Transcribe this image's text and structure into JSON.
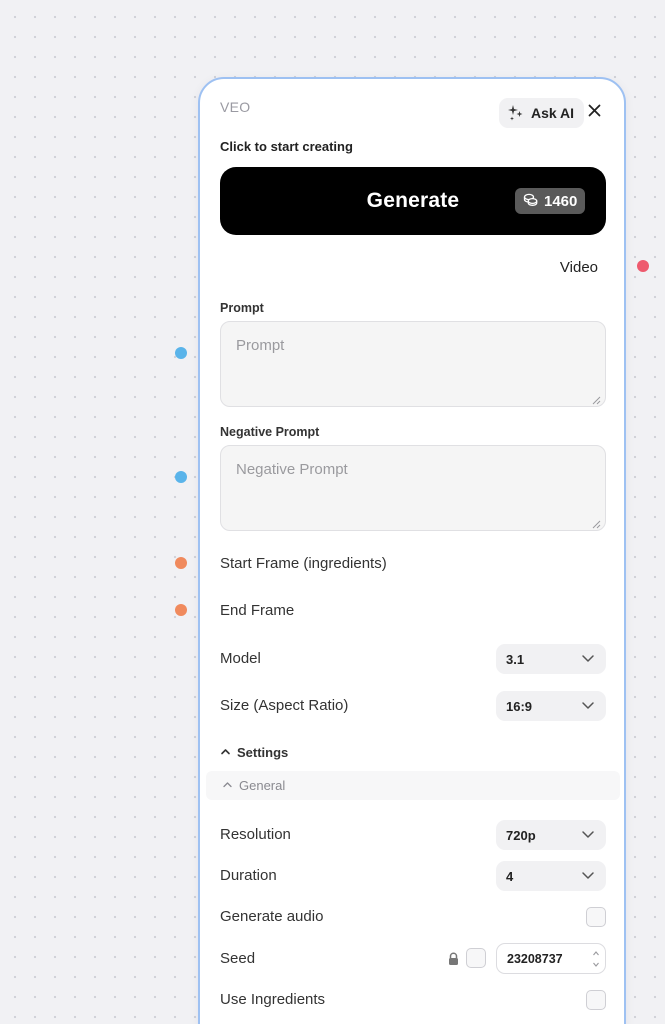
{
  "node": {
    "title": "VEO",
    "ask_ai_label": "Ask AI",
    "hint": "Click to start creating"
  },
  "generate": {
    "label": "Generate",
    "cost": "1460"
  },
  "output": {
    "label": "Video"
  },
  "prompt": {
    "label": "Prompt",
    "placeholder": "Prompt"
  },
  "negative_prompt": {
    "label": "Negative Prompt",
    "placeholder": "Negative Prompt"
  },
  "inputs": {
    "start_frame": "Start Frame (ingredients)",
    "end_frame": "End Frame"
  },
  "model": {
    "label": "Model",
    "value": "3.1"
  },
  "size": {
    "label": "Size (Aspect Ratio)",
    "value": "16:9"
  },
  "settings": {
    "label": "Settings",
    "group_label": "General",
    "resolution": {
      "label": "Resolution",
      "value": "720p"
    },
    "duration": {
      "label": "Duration",
      "value": "4"
    },
    "generate_audio": {
      "label": "Generate audio"
    },
    "seed": {
      "label": "Seed",
      "value": "23208737"
    },
    "use_ingredients": {
      "label": "Use Ingredients"
    }
  },
  "colors": {
    "port_text": "#5ab4ea",
    "port_image": "#f08a5d",
    "port_video": "#ee5a6e",
    "node_border": "#9ec1f2",
    "generate_bg": "#000000"
  },
  "icons": {
    "ask_ai": "sparkle-icon",
    "close": "close-icon",
    "cost": "coins-icon",
    "dropdown": "chevron-down-icon",
    "collapse": "chevron-up-icon",
    "seed_lock": "lock-icon"
  }
}
